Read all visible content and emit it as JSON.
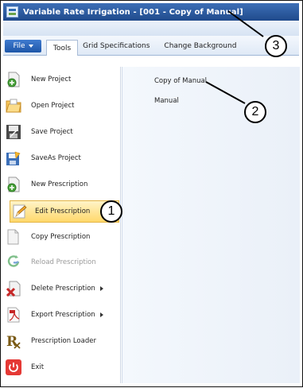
{
  "window": {
    "title": "Variable Rate Irrigation - [001 - Copy of Manual]"
  },
  "menubar": {
    "file_label": "File",
    "tabs": [
      "Tools",
      "Grid Specifications",
      "Change Background"
    ],
    "active_tab": "Tools"
  },
  "sidebar": {
    "items": [
      {
        "label": "New Project",
        "icon": "new-project-icon"
      },
      {
        "label": "Open Project",
        "icon": "open-folder-icon"
      },
      {
        "label": "Save Project",
        "icon": "save-icon"
      },
      {
        "label": "SaveAs Project",
        "icon": "save-as-icon"
      },
      {
        "label": "New Prescription",
        "icon": "new-prescription-icon"
      },
      {
        "label": "Edit Prescription",
        "icon": "edit-pencil-icon",
        "selected": true
      },
      {
        "label": "Copy Prescription",
        "icon": "copy-icon"
      },
      {
        "label": "Reload Prescription",
        "icon": "reload-icon",
        "disabled": true
      },
      {
        "label": "Delete Prescription",
        "icon": "delete-icon",
        "submenu": true
      },
      {
        "label": "Export Prescription",
        "icon": "export-pdf-icon",
        "submenu": true
      },
      {
        "label": "Prescription Loader",
        "icon": "rx-icon"
      },
      {
        "label": "Exit",
        "icon": "power-icon"
      }
    ]
  },
  "prescriptions": {
    "items": [
      "Copy of Manual",
      "Manual"
    ]
  },
  "callouts": [
    "1",
    "2",
    "3"
  ]
}
